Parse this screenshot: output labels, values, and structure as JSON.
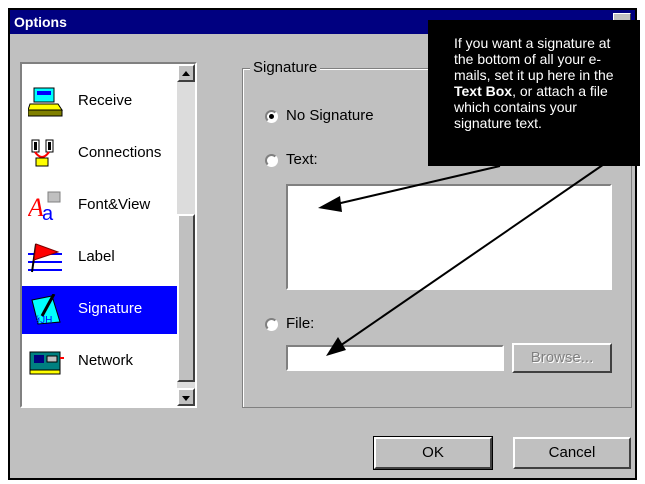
{
  "window": {
    "title": "Options"
  },
  "categories": [
    {
      "label": "Receive",
      "icon": "inbox-tray-icon",
      "selected": false
    },
    {
      "label": "Connections",
      "icon": "network-plug-icon",
      "selected": false
    },
    {
      "label": "Font&View",
      "icon": "font-letters-icon",
      "selected": false
    },
    {
      "label": "Label",
      "icon": "red-flag-icon",
      "selected": false
    },
    {
      "label": "Signature",
      "icon": "signature-pen-icon",
      "selected": true
    },
    {
      "label": "Network",
      "icon": "network-card-icon",
      "selected": false
    }
  ],
  "signature": {
    "group_label": "Signature",
    "no_signature_label": "No Signature",
    "text_label": "Text:",
    "file_label": "File:",
    "text_value": "",
    "file_value": "",
    "browse_label": "Browse...",
    "selected_option": "no_signature"
  },
  "buttons": {
    "ok": "OK",
    "cancel": "Cancel"
  },
  "callout": {
    "part1": "If you want a signature at the bottom of all your e-mails, set it up here in the ",
    "bold": "Text Box",
    "part2": ", or attach a file which contains your signature text."
  },
  "colors": {
    "titlebar": "#000080",
    "selection": "#0000ff",
    "face": "#c0c0c0"
  }
}
